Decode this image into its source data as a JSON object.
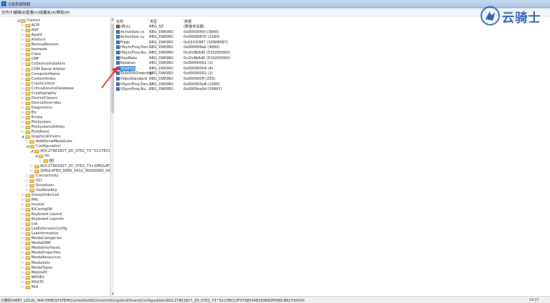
{
  "window": {
    "title": "注册表编辑器"
  },
  "menu": [
    "文件(F)",
    "编辑(E)",
    "查看(V)",
    "收藏夹(A)",
    "帮助(H)"
  ],
  "tree": [
    {
      "label": "Control",
      "level": 0,
      "expanded": true
    },
    {
      "label": "ACPI",
      "level": 1
    },
    {
      "label": "AGP",
      "level": 1
    },
    {
      "label": "AppID",
      "level": 1
    },
    {
      "label": "Arbiters",
      "level": 1
    },
    {
      "label": "BackupRestore",
      "level": 1
    },
    {
      "label": "bootsafe",
      "level": 1
    },
    {
      "label": "Class",
      "level": 1
    },
    {
      "label": "CMF",
      "level": 1
    },
    {
      "label": "CoDeviceInstallers",
      "level": 1
    },
    {
      "label": "COM Name Arbiter",
      "level": 1
    },
    {
      "label": "ComputerName",
      "level": 1
    },
    {
      "label": "ContentIndex",
      "level": 1
    },
    {
      "label": "CrashControl",
      "level": 1
    },
    {
      "label": "CriticalDeviceDatabase",
      "level": 1
    },
    {
      "label": "Cryptography",
      "level": 1
    },
    {
      "label": "DeviceClasses",
      "level": 1
    },
    {
      "label": "DeviceOverrides",
      "level": 1
    },
    {
      "label": "Diagnostics",
      "level": 1
    },
    {
      "label": "Els",
      "level": 1
    },
    {
      "label": "Errata",
      "level": 1
    },
    {
      "label": "FileSystem",
      "level": 1
    },
    {
      "label": "FileSystemUtilities",
      "level": 1
    },
    {
      "label": "FontAssoc",
      "level": 1
    },
    {
      "label": "GraphicsDrivers",
      "level": 1,
      "expanded": true
    },
    {
      "label": "AdditionalModeLists",
      "level": 2
    },
    {
      "label": "Configuration",
      "level": 2,
      "expanded": true
    },
    {
      "label": "AOC27901827_2D_07E2_73^51178CC2",
      "level": 3,
      "expanded": true
    },
    {
      "label": "00",
      "level": 4,
      "expanded": true
    },
    {
      "label": "00",
      "level": 5,
      "selected": true
    },
    {
      "label": "AOC27901827_2D_07E2_73+SIMULATE",
      "level": 3
    },
    {
      "label": "SIMULATED_8086_0412_00000000_00C",
      "level": 3
    },
    {
      "label": "Connectivity",
      "level": 2
    },
    {
      "label": "DCI",
      "level": 2
    },
    {
      "label": "Scheduler",
      "level": 2
    },
    {
      "label": "UseNewKey",
      "level": 2
    },
    {
      "label": "GroupOrderList",
      "level": 1
    },
    {
      "label": "HAL",
      "level": 1
    },
    {
      "label": "hivelist",
      "level": 1
    },
    {
      "label": "IDConfigDB",
      "level": 1
    },
    {
      "label": "Keyboard Layout",
      "level": 1
    },
    {
      "label": "Keyboard Layouts",
      "level": 1
    },
    {
      "label": "Lsa",
      "level": 1
    },
    {
      "label": "LsaExtensionConfig",
      "level": 1
    },
    {
      "label": "LsaInformation",
      "level": 1
    },
    {
      "label": "MediaCategories",
      "level": 1
    },
    {
      "label": "MediaDRM",
      "level": 1
    },
    {
      "label": "MediaInterfaces",
      "level": 1
    },
    {
      "label": "MediaProperties",
      "level": 1
    },
    {
      "label": "MediaResources",
      "level": 1
    },
    {
      "label": "MediaSets",
      "level": 1
    },
    {
      "label": "MediaTypes",
      "level": 1
    },
    {
      "label": "MobilePC",
      "level": 1
    },
    {
      "label": "MPDEV",
      "level": 1
    },
    {
      "label": "MSDTC",
      "level": 1
    },
    {
      "label": "MUI",
      "level": 1
    }
  ],
  "columns": {
    "name": "名称",
    "type": "类型",
    "data": "数据"
  },
  "values": [
    {
      "name": "(默认)",
      "type": "REG_SZ",
      "data": "(数值未设置)",
      "icon": "string"
    },
    {
      "name": "ActiveSize.cx",
      "type": "REG_DWORD",
      "data": "0x00000f00 (3840)",
      "icon": "binary"
    },
    {
      "name": "ActiveSize.cy",
      "type": "REG_DWORD",
      "data": "0x00000870 (2160)",
      "icon": "binary"
    },
    {
      "name": "Flags",
      "type": "REG_DWORD",
      "data": "0x0101f987 (16906567)",
      "icon": "binary"
    },
    {
      "name": "HSyncFreq.Den...",
      "type": "REG_DWORD",
      "data": "0x000009a0 (4000)",
      "icon": "binary"
    },
    {
      "name": "HSyncFreq.Nu...",
      "type": "REG_DWORD",
      "data": "0x1fc8b6d0 (533250000)",
      "icon": "binary"
    },
    {
      "name": "PixelRate",
      "type": "REG_DWORD",
      "data": "0x1fc8b6d0 (533250000)",
      "icon": "binary"
    },
    {
      "name": "Rotation",
      "type": "REG_DWORD",
      "data": "0x00000001 (1)",
      "icon": "binary"
    },
    {
      "name": "Scaling",
      "type": "REG_DWORD",
      "data": "0x00000004 (4)",
      "icon": "binary",
      "selected": true
    },
    {
      "name": "ScanlineOrdering",
      "type": "REG_DWORD",
      "data": "0x00000001 (1)",
      "icon": "binary"
    },
    {
      "name": "VideoStandard",
      "type": "REG_DWORD",
      "data": "0x000000ff (255)",
      "icon": "binary"
    },
    {
      "name": "VSyncFreq.Den...",
      "type": "REG_DWORD",
      "data": "0x000003e8 (1000)",
      "icon": "binary"
    },
    {
      "name": "VSyncFreq.Nu...",
      "type": "REG_DWORD",
      "data": "0x0000ea5d (59997)",
      "icon": "binary"
    }
  ],
  "status": {
    "path": "计算机\\HKEY_LOCAL_MACHINE\\SYSTEM\\ControlSet001\\Control\\GraphicsDrivers\\Configuration\\AOC27901827_2D_07E2_73^51178CC2F570853AB1EAB93F666CB627\\00\\00"
  },
  "clock": "14:27",
  "watermark": {
    "text": "云骑士"
  },
  "colors": {
    "accent": "#3399ff",
    "annotation": "#e0332b",
    "watermark": "#2b63b7"
  }
}
